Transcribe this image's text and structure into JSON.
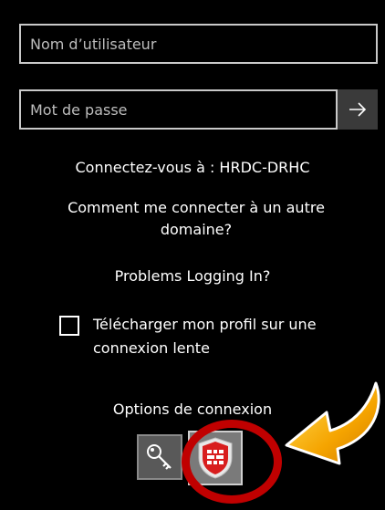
{
  "login": {
    "username_placeholder": "Nom d’utilisateur",
    "password_placeholder": "Mot de passe",
    "submit_icon": "arrow-right-icon",
    "connect_to": "Connectez-vous à : HRDC-DRHC",
    "other_domain": "Comment me connecter à un autre domaine?",
    "problems": "Problems Logging In?",
    "slow_connection_label": "Télécharger mon profil sur une connexion lente",
    "slow_connection_checked": false
  },
  "signin_options": {
    "title": "Options de connexion",
    "options": [
      {
        "icon": "key-icon",
        "selected": false
      },
      {
        "icon": "shield-icon",
        "selected": true
      }
    ]
  },
  "colors": {
    "background": "#000000",
    "highlight_ring": "#c00000",
    "arrow": "#f5a400"
  }
}
